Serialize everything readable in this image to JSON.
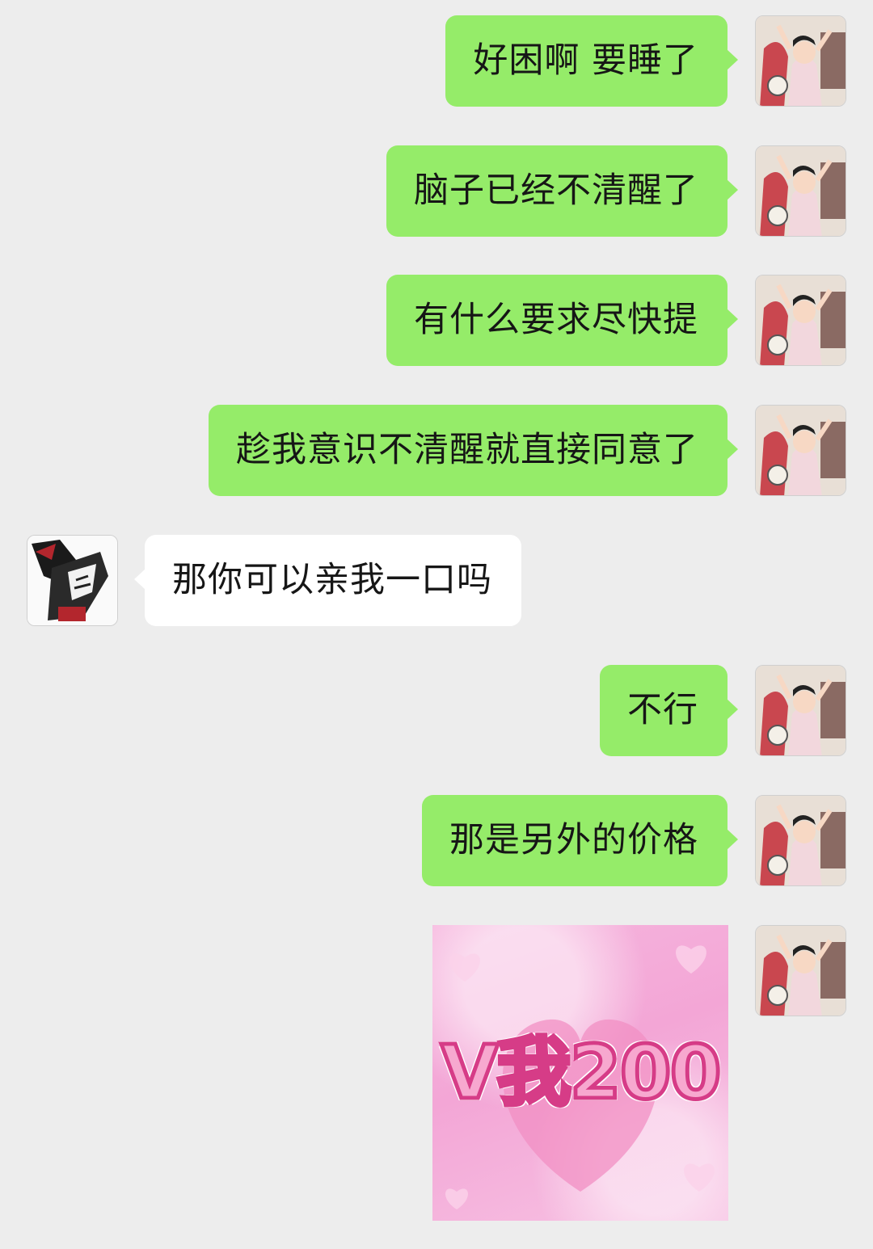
{
  "messages": [
    {
      "side": "me",
      "text": "好困啊 要睡了"
    },
    {
      "side": "me",
      "text": "脑子已经不清醒了"
    },
    {
      "side": "me",
      "text": "有什么要求尽快提"
    },
    {
      "side": "me",
      "text": "趁我意识不清醒就直接同意了"
    },
    {
      "side": "other",
      "text": "那你可以亲我一口吗"
    },
    {
      "side": "me",
      "text": "不行"
    },
    {
      "side": "me",
      "text": "那是另外的价格"
    }
  ],
  "sticker": {
    "text": "V我200"
  },
  "colors": {
    "background": "#ededed",
    "my_bubble": "#95ec69",
    "other_bubble": "#ffffff",
    "sticker_outline": "#d63c87"
  },
  "avatars": {
    "me": "cartoon-avatar-icon",
    "other": "manga-avatar-icon"
  }
}
